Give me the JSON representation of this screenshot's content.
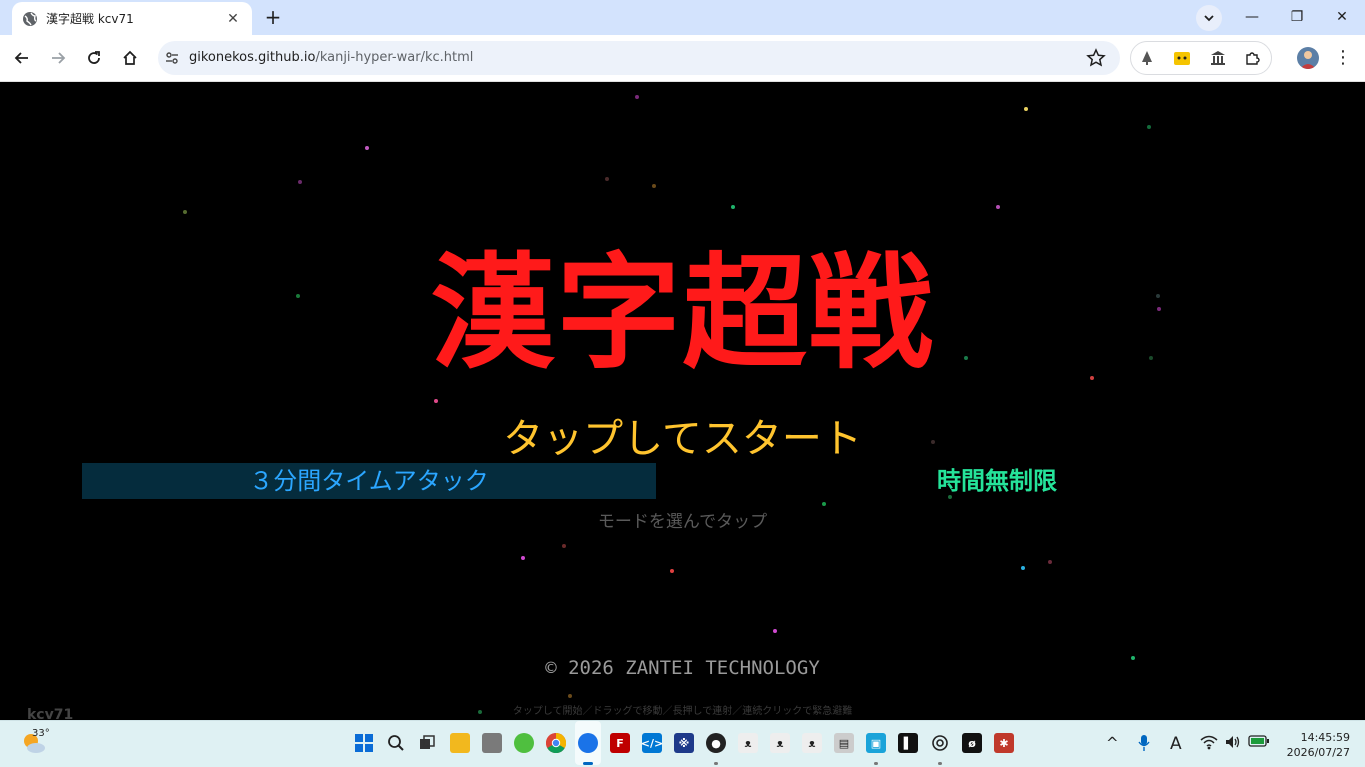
{
  "browser": {
    "tab_title": "漢字超戦 kcv71",
    "tab_close": "✕",
    "new_tab": "+",
    "url_host": "gikonekos.github.io",
    "url_path": "/kanji-hyper-war/kc.html",
    "window_controls": {
      "minimize": "—",
      "restore": "❐",
      "close": "✕"
    },
    "kebab": "⋮"
  },
  "game": {
    "title": "漢字超戦",
    "subtitle": "タップしてスタート",
    "mode_timed": "３分間タイムアタック",
    "mode_unlimited": "時間無制限",
    "mode_hint": "モードを選んでタップ",
    "copyright": "© 2026 ZANTEI TECHNOLOGY",
    "controls_hint": "タップして開始／ドラッグで移動／長押しで連射／連続クリックで緊急避難",
    "version": "kcv71",
    "colors": {
      "title": "#ff1a1a",
      "subtitle": "#ffc42e",
      "mode_timed_text": "#2ba6ff",
      "mode_timed_bg": "#052c3d",
      "mode_unlimited": "#25e39a"
    }
  },
  "taskbar": {
    "weather_temp": "33°",
    "time": "14:45:59",
    "date": "2026/07/27",
    "tray_ime": "A",
    "tray_chevron": "^"
  }
}
